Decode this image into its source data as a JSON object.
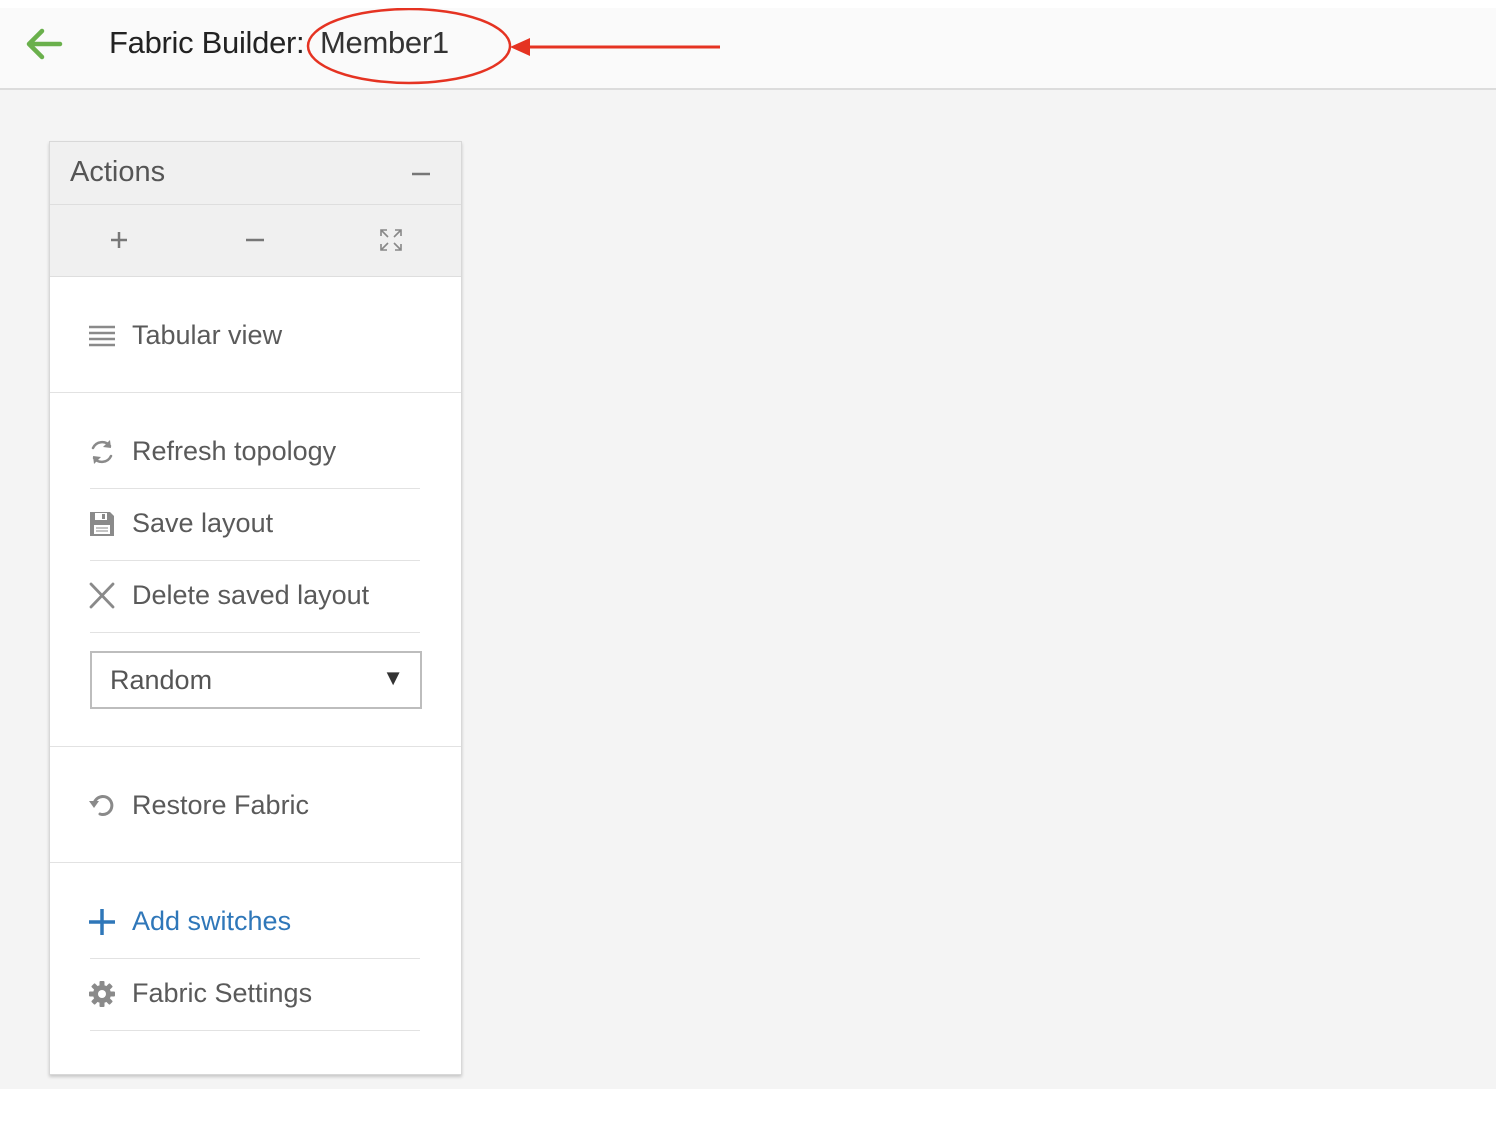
{
  "header": {
    "title": "Fabric Builder:",
    "fabric_name": "Member1",
    "back_icon": "arrow-left-icon",
    "back_color": "#6ab04c"
  },
  "annotation": {
    "color": "#e53322"
  },
  "panel": {
    "title": "Actions",
    "collapse_icon": "minus-icon",
    "zoom_controls": [
      "zoom-in-icon",
      "zoom-out-icon",
      "fit-to-screen-icon"
    ],
    "items": [
      {
        "label": "Tabular view",
        "icon": "list-icon"
      },
      {
        "label": "Refresh topology",
        "icon": "refresh-icon"
      },
      {
        "label": "Save layout",
        "icon": "save-icon"
      },
      {
        "label": "Delete saved layout",
        "icon": "close-icon"
      },
      {
        "label": "Restore Fabric",
        "icon": "restore-icon"
      },
      {
        "label": "Add switches",
        "icon": "plus-icon",
        "color": "#2f77b9"
      },
      {
        "label": "Fabric Settings",
        "icon": "gear-icon"
      }
    ],
    "layout_select": {
      "value": "Random"
    }
  }
}
